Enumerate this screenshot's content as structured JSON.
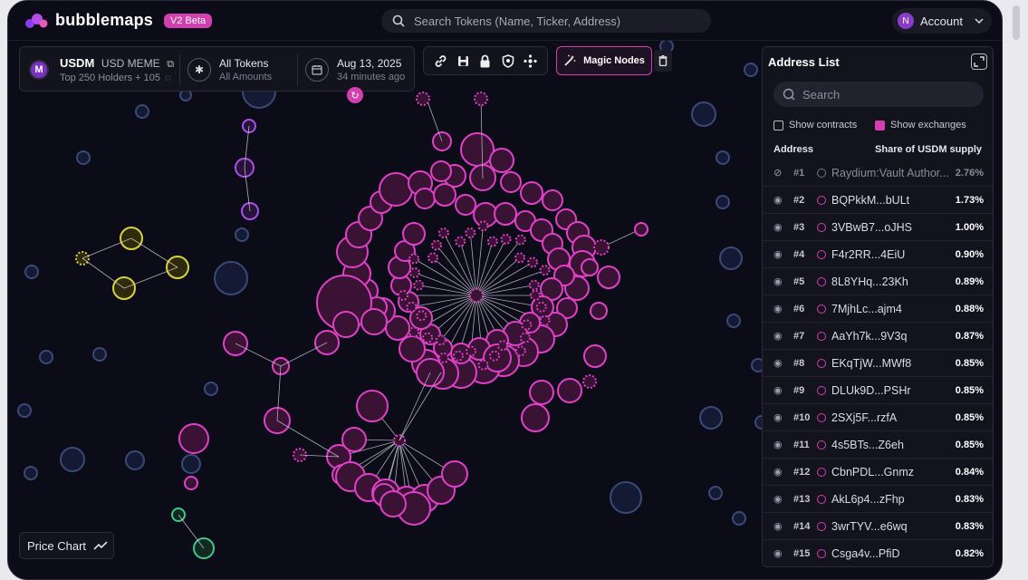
{
  "app": {
    "name": "bubblemaps",
    "badge": "V2 Beta"
  },
  "search": {
    "placeholder": "Search Tokens (Name, Ticker, Address)"
  },
  "account": {
    "avatar_letter": "N",
    "label": "Account"
  },
  "token": {
    "symbol": "USDM",
    "name": "USD MEME",
    "icon_letter": "M",
    "holders": "Top 250 Holders + 105"
  },
  "filter": {
    "title": "All Tokens",
    "subtitle": "All Amounts"
  },
  "snapshot": {
    "date": "Aug 13, 2025",
    "ago": "34 minutes ago"
  },
  "toolbar": {
    "magic_label": "Magic Nodes"
  },
  "panel": {
    "title": "Address List",
    "search_placeholder": "Search",
    "show_contracts": "Show contracts",
    "show_exchanges": "Show exchanges",
    "col_address": "Address",
    "col_share": "Share of USDM supply",
    "rows": [
      {
        "rank": "#1",
        "address": "Raydium:Vault Author...",
        "pct": "2.76%",
        "dim": true
      },
      {
        "rank": "#2",
        "address": "BQPkkM...bULt",
        "pct": "1.73%"
      },
      {
        "rank": "#3",
        "address": "3VBwB7...oJHS",
        "pct": "1.00%"
      },
      {
        "rank": "#4",
        "address": "F4r2RR...4EiU",
        "pct": "0.90%"
      },
      {
        "rank": "#5",
        "address": "8L8YHq...23Kh",
        "pct": "0.89%"
      },
      {
        "rank": "#6",
        "address": "7MjhLc...ajm4",
        "pct": "0.88%"
      },
      {
        "rank": "#7",
        "address": "AaYh7k...9V3q",
        "pct": "0.87%"
      },
      {
        "rank": "#8",
        "address": "EKqTjW...MWf8",
        "pct": "0.85%"
      },
      {
        "rank": "#9",
        "address": "DLUk9D...PSHr",
        "pct": "0.85%"
      },
      {
        "rank": "#10",
        "address": "2SXj5F...rzfA",
        "pct": "0.85%"
      },
      {
        "rank": "#11",
        "address": "4s5BTs...Z6eh",
        "pct": "0.85%"
      },
      {
        "rank": "#12",
        "address": "CbnPDL...Gnmz",
        "pct": "0.84%"
      },
      {
        "rank": "#13",
        "address": "AkL6p4...zFhp",
        "pct": "0.83%"
      },
      {
        "rank": "#14",
        "address": "3wrTYV...e6wq",
        "pct": "0.83%"
      },
      {
        "rank": "#15",
        "address": "Csga4v...PfiD",
        "pct": "0.82%"
      }
    ]
  },
  "price_chart": {
    "label": "Price Chart"
  },
  "colors": {
    "accent": "#d43fb0",
    "bubble_pink": "#e040c8",
    "bubble_yellow": "#d8d23a",
    "bubble_purple": "#a850e8",
    "bubble_green": "#3ec88a",
    "bubble_blue": "#3a4a78"
  }
}
